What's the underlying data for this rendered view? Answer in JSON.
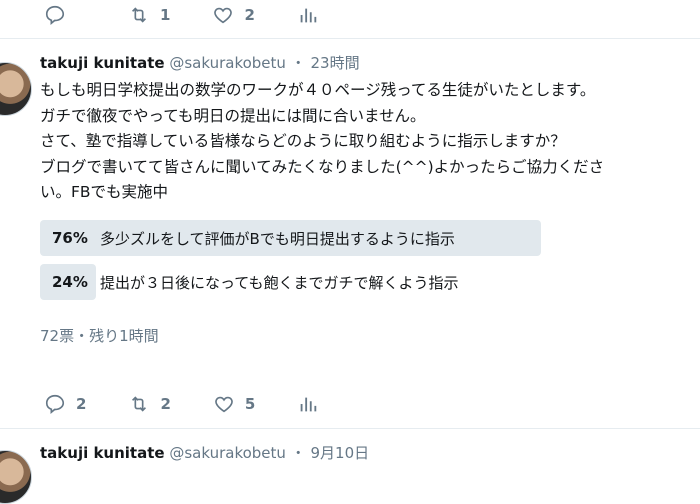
{
  "top_actions": {
    "reply_count": "",
    "retweet_count": "1",
    "like_count": "2"
  },
  "tweet": {
    "name": "takuji kunitate",
    "handle": "@sakurakobetu",
    "separator": "・",
    "time": "23時間",
    "lines": [
      "もしも明日学校提出の数学のワークが４０ページ残ってる生徒がいたとします。",
      "ガチで徹夜でやっても明日の提出には間に合いません。",
      "さて、塾で指導している皆様ならどのように取り組むように指示しますか？",
      "ブログで書いてて皆さんに聞いてみたくなりました(^^)よかったらご協力くださ",
      "い。FBでも実施中"
    ],
    "poll": {
      "options": [
        {
          "percent_label": "76%",
          "percent": 76,
          "text": "多少ズルをして評価がBでも明日提出するように指示"
        },
        {
          "percent_label": "24%",
          "percent": 24,
          "text": "提出が３日後になっても飽くまでガチで解くよう指示"
        }
      ],
      "meta": "72票・残り1時間"
    },
    "actions": {
      "reply_count": "2",
      "retweet_count": "2",
      "like_count": "5"
    }
  },
  "next_tweet": {
    "name": "takuji kunitate",
    "handle": "@sakurakobetu",
    "separator": "・",
    "time": "9月10日"
  },
  "colors": {
    "text": "#14171a",
    "muted": "#657786",
    "poll_bar": "#e1e8ed",
    "divider": "#e6ecf0"
  },
  "icons": [
    "reply-icon",
    "retweet-icon",
    "like-icon",
    "analytics-icon"
  ]
}
